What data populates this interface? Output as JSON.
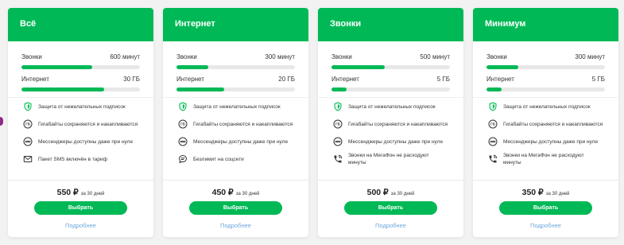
{
  "colors": {
    "brand_green": "#00B956",
    "nav_purple": "#8E2A8A",
    "link_blue": "#6FA8DC",
    "bar_track": "#E8E8E8",
    "page_background": "#F2F2F2"
  },
  "icons": {
    "gb_label": "ГБ"
  },
  "tariffs": [
    {
      "title": "Всё",
      "calls": {
        "label": "Звонки",
        "value": "600 минут",
        "fill": 0.6
      },
      "internet": {
        "label": "Интернет",
        "value": "30 ГБ",
        "fill": 0.7
      },
      "features": [
        {
          "icon": "shield-icon",
          "text": "Защита от нежелательных подписок"
        },
        {
          "icon": "gb-icon",
          "text": "Гигабайты сохраняются и накапливаются"
        },
        {
          "icon": "messenger-icon",
          "text": "Мессенджеры доступны даже при нуле"
        },
        {
          "icon": "envelope-icon",
          "text": "Пакет SMS включён в тариф"
        }
      ],
      "price": {
        "amount": "550 ₽",
        "period": "за 30 дней"
      },
      "button_label": "Выбрать",
      "details_link": "Подробнее"
    },
    {
      "title": "Интернет",
      "calls": {
        "label": "Звонки",
        "value": "300 минут",
        "fill": 0.27
      },
      "internet": {
        "label": "Интернет",
        "value": "20 ГБ",
        "fill": 0.4
      },
      "features": [
        {
          "icon": "shield-icon",
          "text": "Защита от нежелательных подписок"
        },
        {
          "icon": "gb-icon",
          "text": "Гигабайты сохраняются и накапливаются"
        },
        {
          "icon": "messenger-icon",
          "text": "Мессенджеры доступны даже при нуле"
        },
        {
          "icon": "chat-bubble-icon",
          "text": "Безлимит на соцсети"
        }
      ],
      "price": {
        "amount": "450 ₽",
        "period": "за 30 дней"
      },
      "button_label": "Выбрать",
      "details_link": "Подробнее"
    },
    {
      "title": "Звонки",
      "calls": {
        "label": "Звонки",
        "value": "500 минут",
        "fill": 0.45
      },
      "internet": {
        "label": "Интернет",
        "value": "5 ГБ",
        "fill": 0.13
      },
      "features": [
        {
          "icon": "shield-icon",
          "text": "Защита от нежелательных подписок"
        },
        {
          "icon": "gb-icon",
          "text": "Гигабайты сохраняются и накапливаются"
        },
        {
          "icon": "messenger-icon",
          "text": "Мессенджеры доступны даже при нуле"
        },
        {
          "icon": "phone-icon",
          "text": "Звонки на МегаФон не расходуют минуты"
        }
      ],
      "price": {
        "amount": "500 ₽",
        "period": "за 30 дней"
      },
      "button_label": "Выбрать",
      "details_link": "Подробнее"
    },
    {
      "title": "Минимум",
      "calls": {
        "label": "Звонки",
        "value": "300 минут",
        "fill": 0.27
      },
      "internet": {
        "label": "Интернет",
        "value": "5 ГБ",
        "fill": 0.13
      },
      "features": [
        {
          "icon": "shield-icon",
          "text": "Защита от нежелательных подписок"
        },
        {
          "icon": "gb-icon",
          "text": "Гигабайты сохраняются и накапливаются"
        },
        {
          "icon": "messenger-icon",
          "text": "Мессенджеры доступны даже при нуле"
        },
        {
          "icon": "phone-icon",
          "text": "Звонки на МегаФон не расходуют минуты"
        }
      ],
      "price": {
        "amount": "350 ₽",
        "period": "за 30 дней"
      },
      "button_label": "Выбрать",
      "details_link": "Подробнее"
    }
  ]
}
